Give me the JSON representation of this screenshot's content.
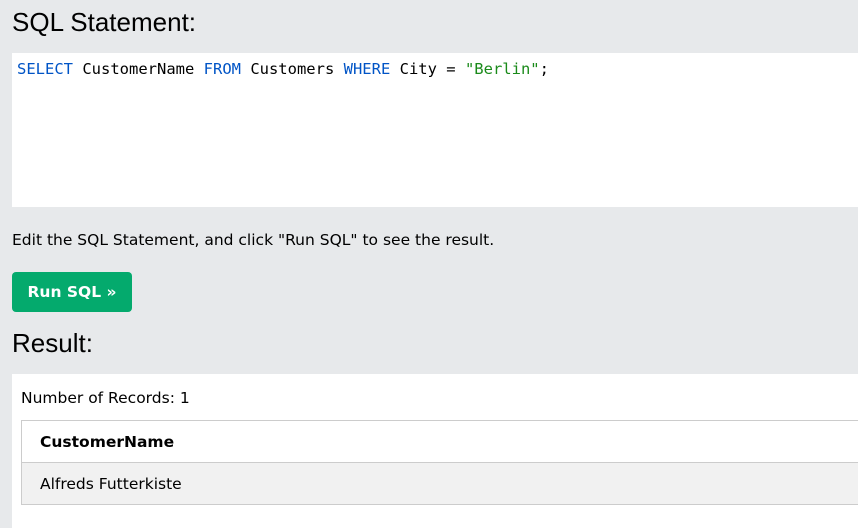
{
  "sql_section": {
    "heading": "SQL Statement:",
    "statement": {
      "kw_select": "SELECT",
      "column": " CustomerName ",
      "kw_from": "FROM",
      "table": " Customers ",
      "kw_where": "WHERE",
      "condition": " City = ",
      "value": "\"Berlin\"",
      "terminator": ";"
    }
  },
  "instructions": "Edit the SQL Statement, and click \"Run SQL\" to see the result.",
  "run_button": {
    "label": "Run SQL »"
  },
  "result_section": {
    "heading": "Result:",
    "records_label": "Number of Records: 1",
    "table": {
      "columns": [
        "CustomerName"
      ],
      "rows": [
        [
          "Alfreds Futterkiste"
        ]
      ]
    }
  },
  "colors": {
    "background": "#e7e9eb",
    "button": "#04aa6d",
    "keyword": "#0054c6",
    "string": "#1a8a1a"
  }
}
